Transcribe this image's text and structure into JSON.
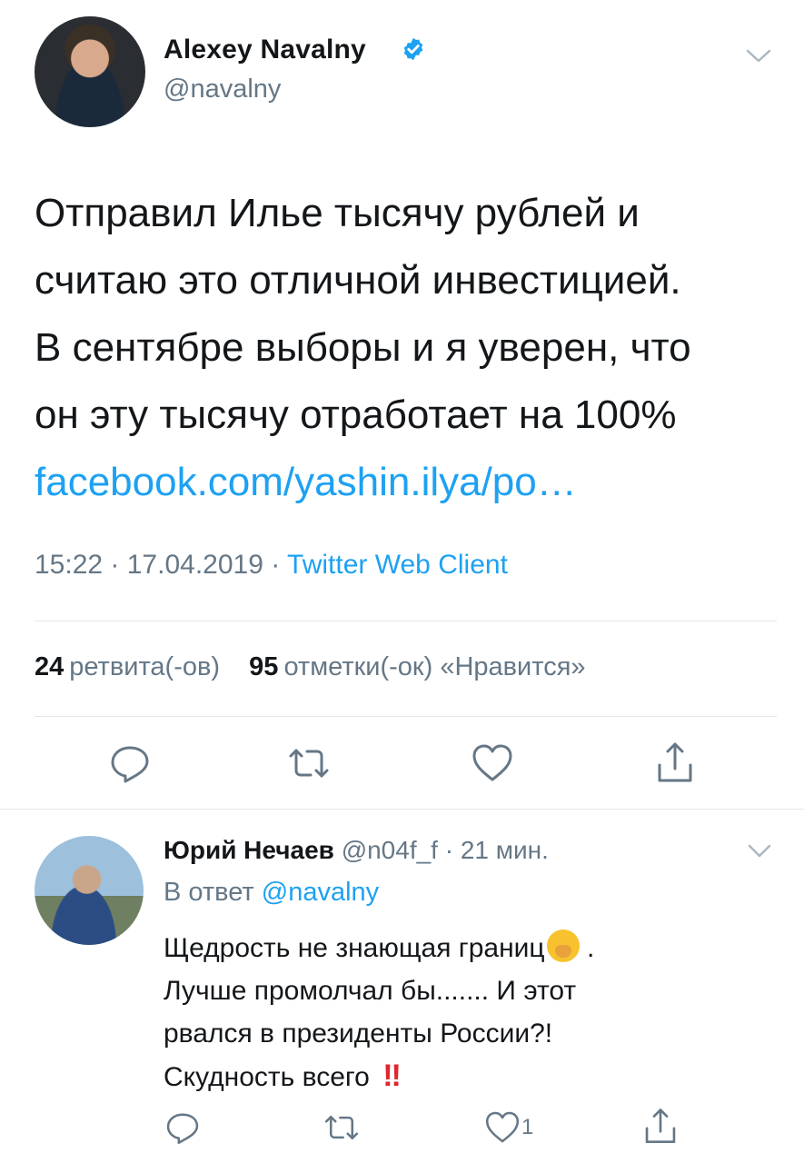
{
  "tweet": {
    "author_name": "Alexey Navalny",
    "author_handle": "@navalny",
    "text_lines": [
      "Отправил Илье тысячу рублей и",
      "считаю это отличной инвестицией.",
      "В сентябре выборы и я уверен, что",
      "он эту тысячу отработает на 100%"
    ],
    "link": "facebook.com/yashin.ilya/po…",
    "time": "15:22",
    "date": "17.04.2019",
    "source": "Twitter Web Client",
    "retweets_count": "24",
    "retweets_label": "ретвита(-ов)",
    "likes_count": "95",
    "likes_label": "отметки(-ок) «Нравится»"
  },
  "reply": {
    "author_name": "Юрий Нечаев",
    "author_handle": "@n04f_f",
    "time_ago": "21 мин.",
    "in_reply_prefix": "В ответ",
    "in_reply_handle": "@navalny",
    "text_line1": "Щедрость не знающая границ",
    "text_line1_end": ".",
    "text_line2": "Лучше промолчал бы....... И этот",
    "text_line3": "рвался в президенты России?!",
    "text_line4": "Скудность всего",
    "text_emoji_end": "‼",
    "like_count": "1"
  },
  "icons": {
    "verified": "verified-badge-icon",
    "reply": "reply-icon",
    "retweet": "retweet-icon",
    "like": "heart-icon",
    "share": "share-icon",
    "menu": "chevron-down-icon"
  },
  "colors": {
    "accent": "#1da1f2",
    "secondary_text": "#657786",
    "primary_text": "#14171a",
    "divider": "#e1e8ed"
  }
}
